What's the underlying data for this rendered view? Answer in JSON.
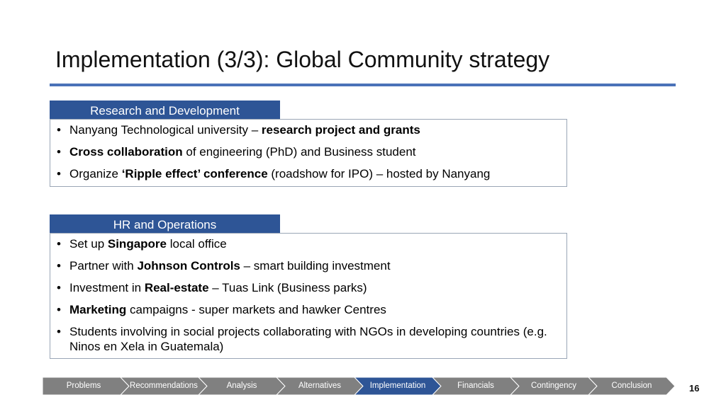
{
  "slide": {
    "title": "Implementation (3/3): Global Community strategy",
    "page_number": "16"
  },
  "sections": {
    "rd": {
      "header": "Research and Development",
      "items": [
        {
          "pre": "Nanyang Technological university – ",
          "bold": "research project and grants",
          "post": ""
        },
        {
          "pre": "",
          "bold": "Cross collaboration",
          "post": " of engineering (PhD) and Business student"
        },
        {
          "pre": "Organize ",
          "bold": "‘Ripple effect’ conference",
          "post": " (roadshow for IPO) – hosted by Nanyang"
        }
      ]
    },
    "hr": {
      "header": "HR and Operations",
      "items": [
        {
          "pre": "Set up ",
          "bold": "Singapore",
          "post": " local office"
        },
        {
          "pre": "Partner with ",
          "bold": "Johnson Controls",
          "post": " – smart building investment"
        },
        {
          "pre": "Investment in ",
          "bold": "Real-estate",
          "post": " – Tuas Link (Business parks)"
        },
        {
          "pre": "",
          "bold": "Marketing",
          "post": " campaigns - super markets and hawker Centres"
        },
        {
          "pre": "Students involving in social projects collaborating with NGOs in developing countries (e.g. Ninos en Xela in Guatemala)",
          "bold": "",
          "post": ""
        }
      ]
    }
  },
  "nav": {
    "steps": [
      "Problems",
      "Recommendations",
      "Analysis",
      "Alternatives",
      "Implementation",
      "Financials",
      "Contingency",
      "Conclusion"
    ],
    "active_index": 4,
    "colors": {
      "inactive": "#808080",
      "active": "#2e5596",
      "separator": "#ffffff"
    }
  }
}
